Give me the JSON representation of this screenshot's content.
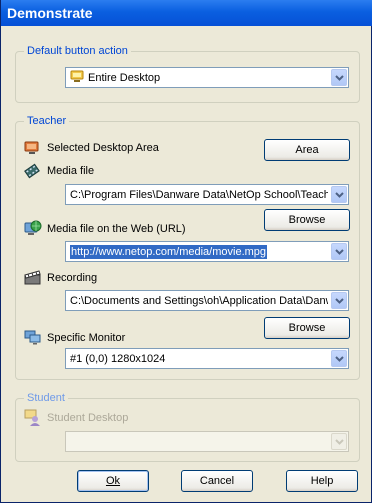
{
  "window": {
    "title": "Demonstrate"
  },
  "default_action": {
    "group_title": "Default button action",
    "selected": "Entire Desktop",
    "icon": "desktop-icon"
  },
  "teacher": {
    "group_title": "Teacher",
    "selected_area": {
      "label": "Selected Desktop Area",
      "button": "Area",
      "icon": "desktop-area-icon"
    },
    "media_file": {
      "label": "Media file",
      "value": "C:\\Program Files\\Danware Data\\NetOp School\\Teache",
      "icon": "film-icon"
    },
    "media_web": {
      "label": "Media file on the Web (URL)",
      "button": "Browse",
      "value": "http://www.netop.com/media/movie.mpg",
      "icon": "globe-computer-icon"
    },
    "recording": {
      "label": "Recording",
      "value": "C:\\Documents and Settings\\oh\\Application Data\\Danw",
      "icon": "clapperboard-icon"
    },
    "specific_monitor": {
      "label": "Specific Monitor",
      "button": "Browse",
      "value": "#1 (0,0) 1280x1024",
      "icon": "monitors-icon"
    }
  },
  "student": {
    "group_title": "Student",
    "desktop": {
      "label": "Student Desktop",
      "value": "",
      "icon": "student-desktop-icon"
    }
  },
  "buttons": {
    "ok": "Ok",
    "cancel": "Cancel",
    "help": "Help"
  },
  "colors": {
    "titlebar": "#0a5fe0",
    "group_title": "#0046d5",
    "selection": "#316ac5"
  }
}
